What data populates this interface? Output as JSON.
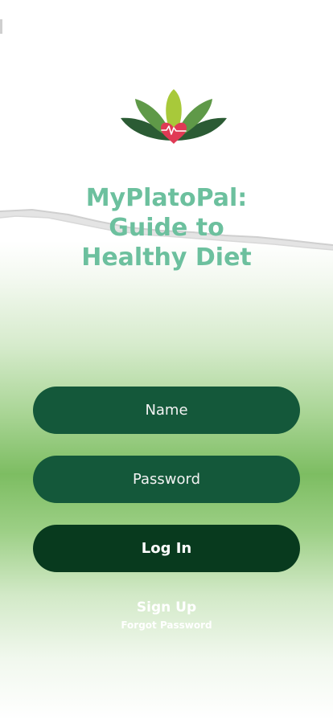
{
  "app": {
    "title_line1": "MyPlatoPal:",
    "title_line2": "Guide to",
    "title_line3": "Healthy Diet",
    "logo_icon": "lotus-heart-icon"
  },
  "form": {
    "name_placeholder": "Name",
    "password_placeholder": "Password",
    "login_label": "Log In"
  },
  "links": {
    "signup": "Sign Up",
    "forgot_password": "Forgot Password"
  },
  "colors": {
    "title": "#6cc09e",
    "field_background": "#14583a",
    "button_background": "#083a1e",
    "gradient_green": "#7dbd62"
  }
}
